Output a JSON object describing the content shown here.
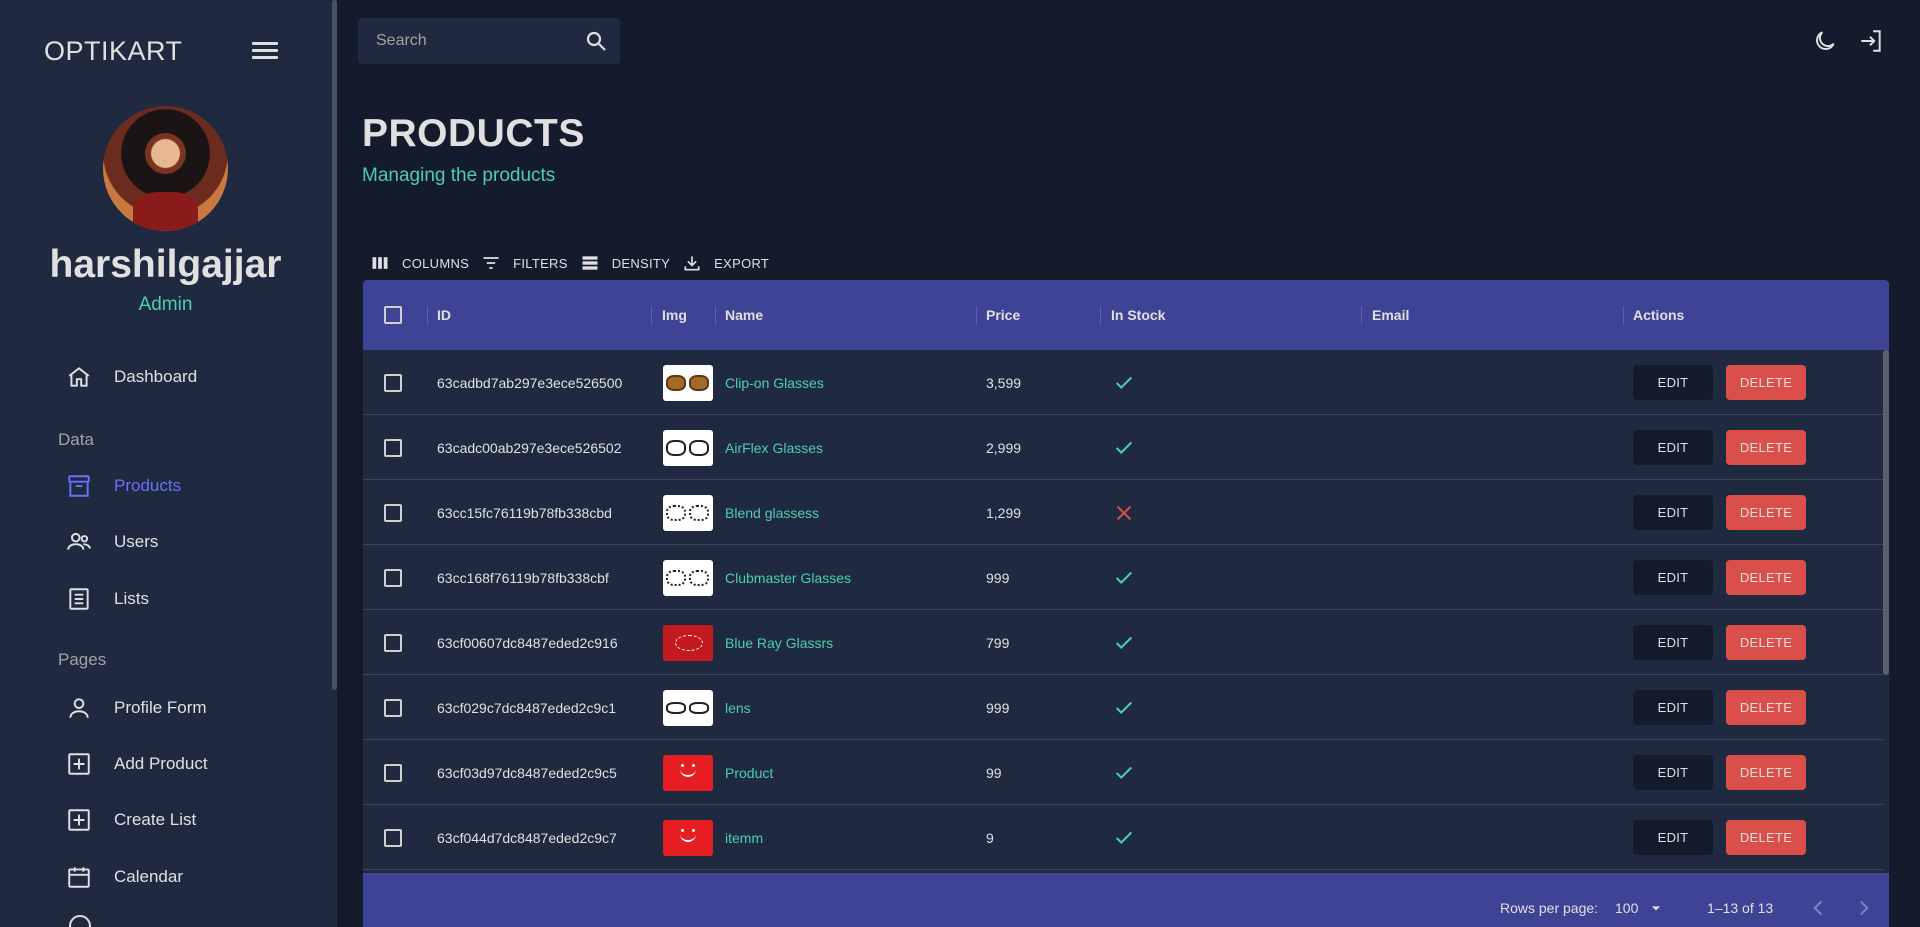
{
  "sidebar": {
    "brand": "OPTIKART",
    "username": "harshilgajjar",
    "role": "Admin",
    "items": [
      {
        "label": "Dashboard"
      },
      {
        "label": "Products"
      },
      {
        "label": "Users"
      },
      {
        "label": "Lists"
      },
      {
        "label": "Profile Form"
      },
      {
        "label": "Add Product"
      },
      {
        "label": "Create List"
      },
      {
        "label": "Calendar"
      }
    ],
    "sections": {
      "data": "Data",
      "pages": "Pages"
    },
    "active_item": "Products"
  },
  "topbar": {
    "search_placeholder": "Search"
  },
  "header": {
    "title": "PRODUCTS",
    "subtitle": "Managing the products"
  },
  "toolbar": {
    "columns": "COLUMNS",
    "filters": "FILTERS",
    "density": "DENSITY",
    "export": "EXPORT"
  },
  "table": {
    "headers": {
      "id": "ID",
      "img": "Img",
      "name": "Name",
      "price": "Price",
      "in_stock": "In Stock",
      "email": "Email",
      "actions": "Actions"
    },
    "rows": [
      {
        "id": "63cadbd7ab297e3ece526500",
        "name": "Clip-on Glasses",
        "price": "3,599",
        "in_stock": true,
        "img": "tinted-glasses"
      },
      {
        "id": "63cadc00ab297e3ece526502",
        "name": "AirFlex Glasses",
        "price": "2,999",
        "in_stock": true,
        "img": "glasses"
      },
      {
        "id": "63cc15fc76119b78fb338cbd",
        "name": "Blend glassess",
        "price": "1,299",
        "in_stock": false,
        "img": "glasses"
      },
      {
        "id": "63cc168f76119b78fb338cbf",
        "name": "Clubmaster Glasses",
        "price": "999",
        "in_stock": true,
        "img": "glasses"
      },
      {
        "id": "63cf00607dc8487eded2c916",
        "name": "Blue Ray Glassrs",
        "price": "799",
        "in_stock": true,
        "img": "cloud"
      },
      {
        "id": "63cf029c7dc8487eded2c9c1",
        "name": "lens",
        "price": "999",
        "in_stock": true,
        "img": "glasses"
      },
      {
        "id": "63cf03d97dc8487eded2c9c5",
        "name": "Product",
        "price": "99",
        "in_stock": true,
        "img": "red-logo"
      },
      {
        "id": "63cf044d7dc8487eded2c9c7",
        "name": "itemm",
        "price": "9",
        "in_stock": true,
        "img": "red-logo"
      }
    ],
    "edit_label": "EDIT",
    "delete_label": "DELETE"
  },
  "footer": {
    "rows_per_page_label": "Rows per page:",
    "rows_per_page": "100",
    "range": "1–13 of 13"
  },
  "colors": {
    "background": "#141b2d",
    "panel": "#1f2a40",
    "header": "#3e4396",
    "accent_green": "#4cceac",
    "accent_blue": "#6870fa",
    "danger": "#db4f4a"
  }
}
